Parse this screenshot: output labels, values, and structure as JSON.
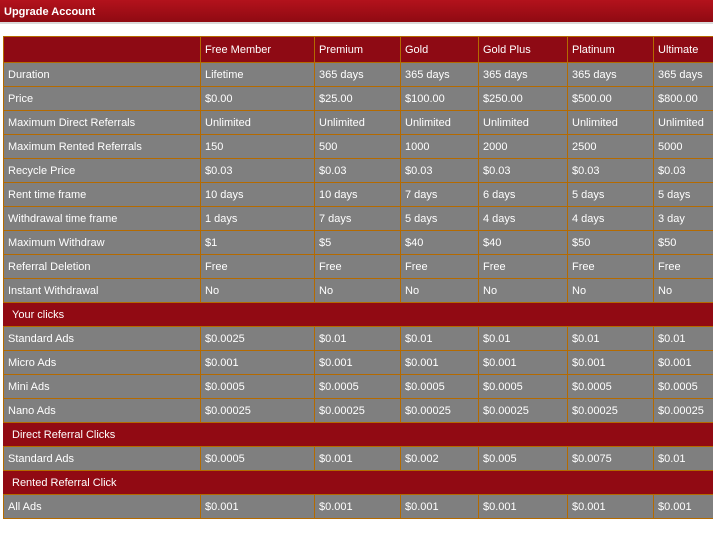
{
  "page": {
    "title": "Upgrade Account"
  },
  "table": {
    "columns": [
      "",
      "Free Member",
      "Premium",
      "Gold",
      "Gold Plus",
      "Platinum",
      "Ultimate"
    ],
    "rows": [
      {
        "label": "Duration",
        "values": [
          "Lifetime",
          "365 days",
          "365 days",
          "365 days",
          "365 days",
          "365 days"
        ]
      },
      {
        "label": "Price",
        "values": [
          "$0.00",
          "$25.00",
          "$100.00",
          "$250.00",
          "$500.00",
          "$800.00"
        ]
      },
      {
        "label": "Maximum Direct Referrals",
        "values": [
          "Unlimited",
          "Unlimited",
          "Unlimited",
          "Unlimited",
          "Unlimited",
          "Unlimited"
        ]
      },
      {
        "label": "Maximum Rented Referrals",
        "values": [
          "150",
          "500",
          "1000",
          "2000",
          "2500",
          "5000"
        ]
      },
      {
        "label": "Recycle Price",
        "values": [
          "$0.03",
          "$0.03",
          "$0.03",
          "$0.03",
          "$0.03",
          "$0.03"
        ]
      },
      {
        "label": "Rent time frame",
        "values": [
          "10 days",
          "10 days",
          "7 days",
          "6 days",
          "5 days",
          "5 days"
        ]
      },
      {
        "label": "Withdrawal time frame",
        "values": [
          "1 days",
          "7 days",
          "5 days",
          "4 days",
          "4 days",
          "3 day"
        ]
      },
      {
        "label": "Maximum Withdraw",
        "values": [
          "$1",
          "$5",
          "$40",
          "$40",
          "$50",
          "$50"
        ]
      },
      {
        "label": "Referral Deletion",
        "values": [
          "Free",
          "Free",
          "Free",
          "Free",
          "Free",
          "Free"
        ]
      },
      {
        "label": "Instant Withdrawal",
        "values": [
          "No",
          "No",
          "No",
          "No",
          "No",
          "No"
        ]
      },
      {
        "section": "Your clicks"
      },
      {
        "label": "Standard Ads",
        "values": [
          "$0.0025",
          "$0.01",
          "$0.01",
          "$0.01",
          "$0.01",
          "$0.01"
        ]
      },
      {
        "label": "Micro Ads",
        "values": [
          "$0.001",
          "$0.001",
          "$0.001",
          "$0.001",
          "$0.001",
          "$0.001"
        ]
      },
      {
        "label": "Mini Ads",
        "values": [
          "$0.0005",
          "$0.0005",
          "$0.0005",
          "$0.0005",
          "$0.0005",
          "$0.0005"
        ]
      },
      {
        "label": "Nano Ads",
        "values": [
          "$0.00025",
          "$0.00025",
          "$0.00025",
          "$0.00025",
          "$0.00025",
          "$0.00025"
        ]
      },
      {
        "section": "Direct Referral Clicks"
      },
      {
        "label": "Standard Ads",
        "values": [
          "$0.0005",
          "$0.001",
          "$0.002",
          "$0.005",
          "$0.0075",
          "$0.01"
        ]
      },
      {
        "section": "Rented Referral Click"
      },
      {
        "label": "All Ads",
        "values": [
          "$0.001",
          "$0.001",
          "$0.001",
          "$0.001",
          "$0.001",
          "$0.001"
        ]
      }
    ]
  },
  "colors": {
    "header_bg": "#8e0a14",
    "section_bg": "#910a13",
    "cell_bg": "#7f7f7f",
    "border": "#b46a00",
    "text": "#ffffff"
  }
}
